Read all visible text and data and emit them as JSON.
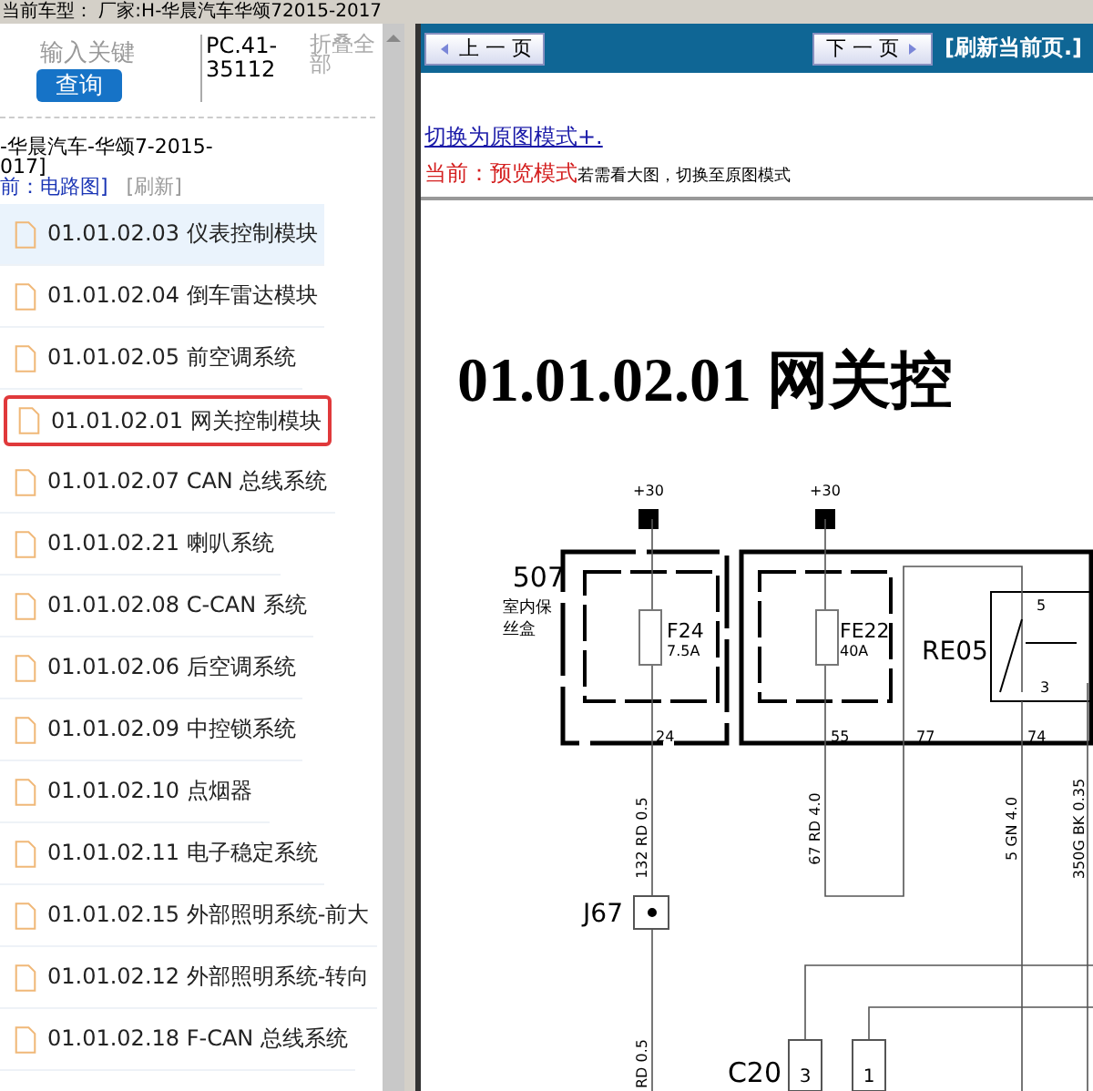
{
  "top_bar": {
    "text": "当前车型： 厂家:H-华晨汽车华颂72015-2017"
  },
  "sidebar": {
    "search": {
      "placeholder": "输入关键"
    },
    "search_button": "查询",
    "code": "PC.41-35112",
    "collapse_all": "折叠全部",
    "vehicle": [
      "-华晨汽车-华颂7-2015-",
      "017]"
    ],
    "current": "前：电路图]",
    "refresh": "[刷新]",
    "items": [
      {
        "label": "01.01.02.03 仪表控制模块",
        "selected": true,
        "highlighted": false
      },
      {
        "label": "01.01.02.04 倒车雷达模块",
        "selected": false,
        "highlighted": false
      },
      {
        "label": "01.01.02.05 前空调系统",
        "selected": false,
        "highlighted": false
      },
      {
        "label": "01.01.02.01 网关控制模块",
        "selected": false,
        "highlighted": true
      },
      {
        "label": "01.01.02.07 CAN 总线系统",
        "selected": false,
        "highlighted": false
      },
      {
        "label": "01.01.02.21 喇叭系统",
        "selected": false,
        "highlighted": false
      },
      {
        "label": "01.01.02.08 C-CAN 系统",
        "selected": false,
        "highlighted": false
      },
      {
        "label": "01.01.02.06 后空调系统",
        "selected": false,
        "highlighted": false
      },
      {
        "label": "01.01.02.09 中控锁系统",
        "selected": false,
        "highlighted": false
      },
      {
        "label": "01.01.02.10 点烟器",
        "selected": false,
        "highlighted": false
      },
      {
        "label": "01.01.02.11 电子稳定系统",
        "selected": false,
        "highlighted": false
      },
      {
        "label": "01.01.02.15 外部照明系统-前大",
        "selected": false,
        "highlighted": false
      },
      {
        "label": "01.01.02.12 外部照明系统-转向",
        "selected": false,
        "highlighted": false
      },
      {
        "label": "01.01.02.18 F-CAN 总线系统",
        "selected": false,
        "highlighted": false
      }
    ]
  },
  "toolbar": {
    "prev": "上 一 页",
    "next": "下 一 页",
    "refresh": "[刷新当前页.]"
  },
  "mode_link": "切换为原图模式+.",
  "mode_status": {
    "label": "当前：预览模式",
    "hint": "若需看大图，切换至原图模式"
  },
  "diagram": {
    "title": "01.01.02.01 网关控",
    "labels": [
      "+30",
      "+30",
      "507",
      "室内保",
      "丝盒",
      "F24",
      "7.5A",
      "FE22",
      "40A",
      "RE05",
      "5",
      "3",
      "24",
      "55",
      "77",
      "74",
      "132 RD 0.5",
      "67 RD 4.0",
      "5 GN 4.0",
      "350G BK 0.35",
      "J67",
      "RD 0.5",
      "C20",
      "3",
      "1"
    ]
  }
}
